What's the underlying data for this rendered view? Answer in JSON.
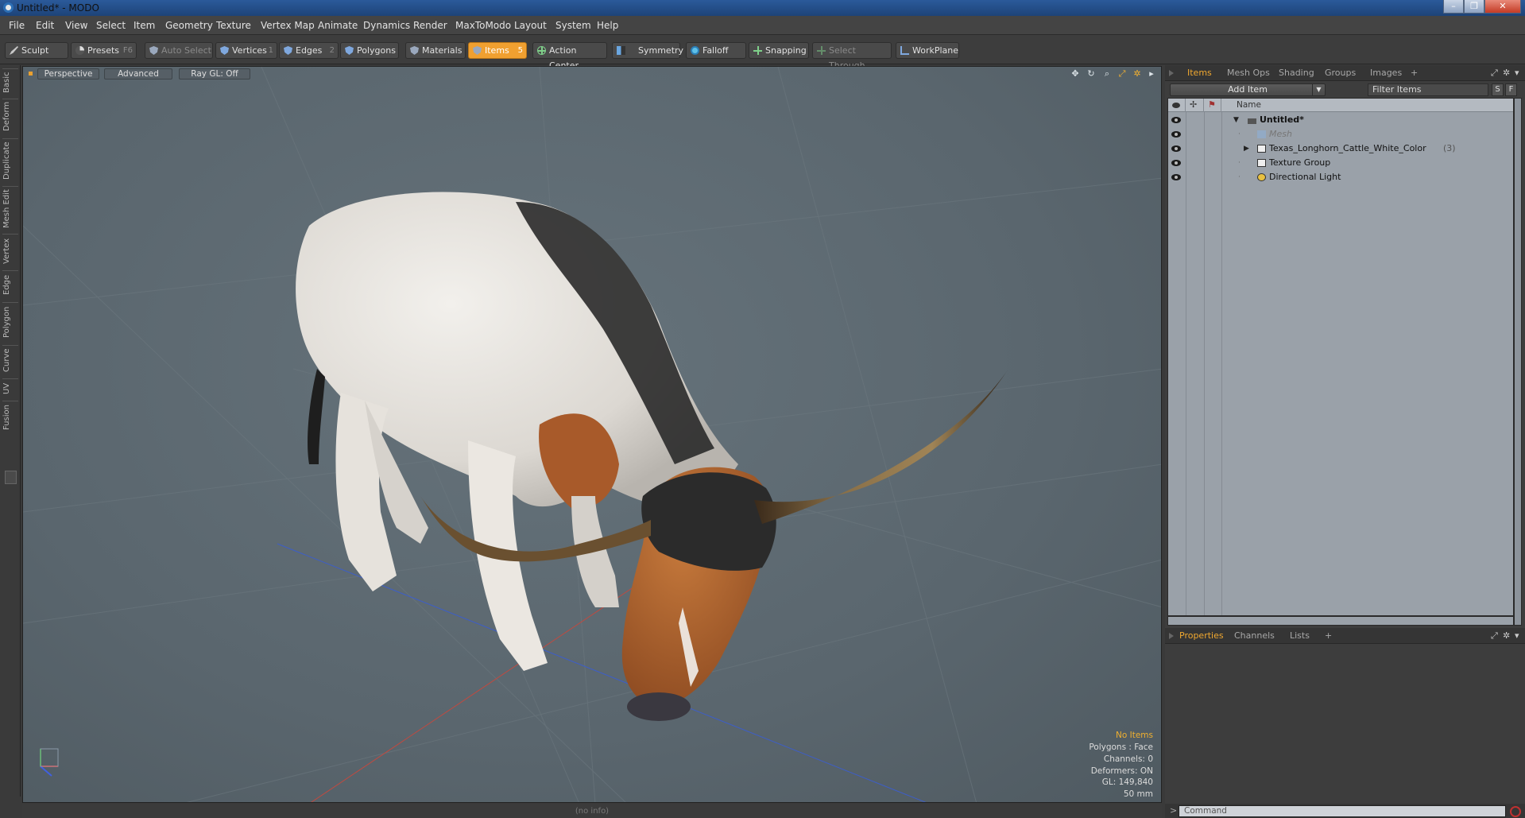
{
  "window": {
    "title": "Untitled* - MODO",
    "min": "–",
    "max": "❐",
    "close": "✕"
  },
  "menu": [
    "File",
    "Edit",
    "View",
    "Select",
    "Item",
    "Geometry",
    "Texture",
    "Vertex Map",
    "Animate",
    "Dynamics",
    "Render",
    "MaxToModo",
    "Layout",
    "System",
    "Help"
  ],
  "toolbar": {
    "sculpt": "Sculpt",
    "presets": "Presets",
    "presets_key": "F6",
    "auto_select": "Auto Select",
    "vertices": "Vertices",
    "vertices_key": "1",
    "edges": "Edges",
    "edges_key": "2",
    "polygons": "Polygons",
    "materials": "Materials",
    "items": "Items",
    "items_key": "5",
    "action_center": "Action Center",
    "symmetry": "Symmetry",
    "falloff": "Falloff",
    "snapping": "Snapping",
    "select_through": "Select Through",
    "workplane": "WorkPlane"
  },
  "left_tabs": [
    "Basic",
    "Deform",
    "Duplicate",
    "Mesh Edit",
    "Vertex",
    "Edge",
    "Polygon",
    "Curve",
    "UV",
    "Fusion"
  ],
  "viewport": {
    "view": "Perspective",
    "shading": "Advanced",
    "raygl": "Ray GL: Off",
    "icons": [
      "move-icon",
      "rotate-icon",
      "zoom-icon",
      "maximize-icon",
      "settings-icon",
      "arrow-right-icon"
    ],
    "info": {
      "selection": "No Items",
      "polygons": "Polygons : Face",
      "channels": "Channels: 0",
      "deformers": "Deformers: ON",
      "gl": "GL: 149,840",
      "scale": "50 mm"
    }
  },
  "status": "(no info)",
  "items_panel": {
    "tabs": [
      "Items",
      "Mesh Ops",
      "Shading",
      "Groups",
      "Images"
    ],
    "add_tab": "+",
    "add_item": "Add Item",
    "filter_placeholder": "Filter Items",
    "s_btn": "S",
    "f_btn": "F",
    "header_name": "Name",
    "tree": [
      {
        "label": "Untitled*",
        "level": 0,
        "expanded": true
      },
      {
        "label": "Mesh",
        "level": 1
      },
      {
        "label": "Texas_Longhorn_Cattle_White_Color",
        "count": "(3)",
        "level": 1,
        "collapsed": true
      },
      {
        "label": "Texture Group",
        "level": 1
      },
      {
        "label": "Directional Light",
        "level": 1
      }
    ]
  },
  "props_panel": {
    "tabs": [
      "Properties",
      "Channels",
      "Lists"
    ],
    "add_tab": "+"
  },
  "command": {
    "prompt": ">",
    "placeholder": "Command"
  },
  "colors": {
    "accent": "#f0a030",
    "viewport_bg": "#5e6a72",
    "tree_bg": "#9aa1a9"
  }
}
